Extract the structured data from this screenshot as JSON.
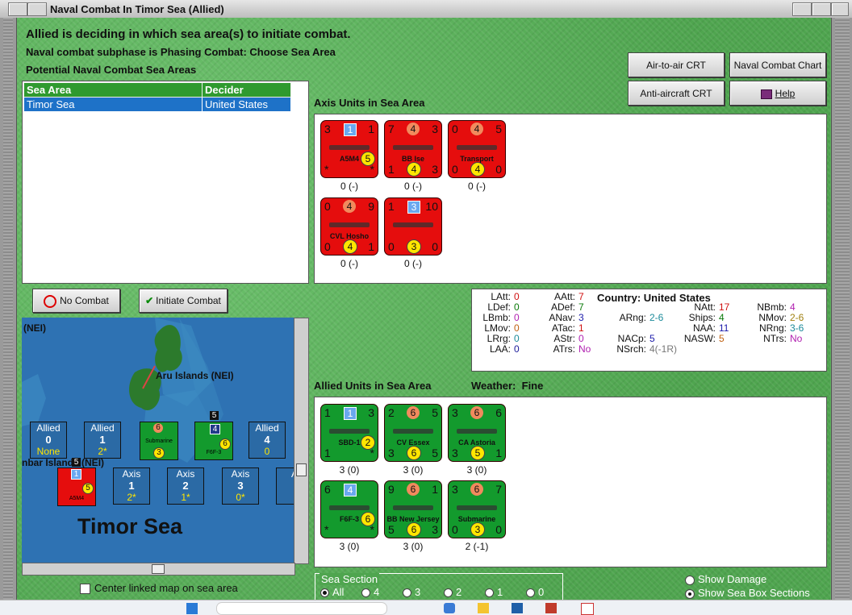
{
  "window": {
    "title": "Naval Combat In Timor Sea (Allied)"
  },
  "header": {
    "line1": "Allied is deciding in which sea area(s) to initiate combat.",
    "line2": "Naval combat subphase is Phasing Combat: Choose Sea Area",
    "line3": "Potential Naval Combat Sea Areas"
  },
  "buttons": {
    "air_to_air": "Air-to-air CRT",
    "naval_chart": "Naval Combat Chart",
    "anti_aircraft": "Anti-aircraft CRT",
    "help": "Help",
    "no_combat": "No Combat",
    "initiate_combat": "Initiate Combat"
  },
  "sea_table": {
    "headers": [
      "Sea Area",
      "Decider"
    ],
    "rows": [
      [
        "Timor Sea",
        "United States"
      ]
    ]
  },
  "axis_section": {
    "label": "Axis Units in Sea Area"
  },
  "axis_units": [
    {
      "name": "A5M4",
      "tl": "3",
      "tr": "1",
      "badge": "1",
      "mid": "5",
      "bl": "*",
      "br": "*",
      "bottom_mid": "",
      "caption": "0 (-)"
    },
    {
      "name": "BB Ise",
      "tl": "7",
      "tr": "3",
      "badge": "4",
      "mid": "",
      "bl": "1",
      "br": "3",
      "bottom_mid": "4",
      "caption": "0 (-)"
    },
    {
      "name": "Transport",
      "tl": "0",
      "tr": "5",
      "badge": "4",
      "mid": "",
      "bl": "0",
      "br": "0",
      "bottom_mid": "4",
      "caption": "0 (-)"
    },
    {
      "name": "CVL Hosho",
      "tl": "0",
      "tr": "9",
      "badge": "4",
      "mid": "",
      "bl": "0",
      "br": "1",
      "bottom_mid": "4",
      "caption": "0 (-)"
    },
    {
      "name": "",
      "tl": "1",
      "tr": "10",
      "badge": "3",
      "mid": "",
      "bl": "0",
      "br": "0",
      "bottom_mid": "3",
      "caption": "0 (-)"
    }
  ],
  "country_stats": {
    "country_label": "Country:",
    "country": "United States",
    "col1": [
      [
        "LAtt:",
        "0"
      ],
      [
        "LDef:",
        "0"
      ],
      [
        "LBmb:",
        "0"
      ],
      [
        "LMov:",
        "0"
      ],
      [
        "LRrg:",
        "0"
      ],
      [
        "LAA:",
        "0"
      ]
    ],
    "col2": [
      [
        "AAtt:",
        "7"
      ],
      [
        "ADef:",
        "7"
      ],
      [
        "ANav:",
        "3"
      ],
      [
        "ATac:",
        "1"
      ],
      [
        "AStr:",
        "0"
      ],
      [
        "ATrs:",
        "No"
      ]
    ],
    "col3": [
      [
        "ARng:",
        "2-6"
      ],
      [
        "NACp:",
        "5"
      ],
      [
        "NSrch:",
        "4(-1R)"
      ]
    ],
    "col4": [
      [
        "NAtt:",
        "17"
      ],
      [
        "Ships:",
        "4"
      ],
      [
        "NAA:",
        "11"
      ],
      [
        "NASW:",
        "5"
      ]
    ],
    "col5": [
      [
        "NBmb:",
        "4"
      ],
      [
        "NMov:",
        "2-6"
      ],
      [
        "NRng:",
        "3-6"
      ],
      [
        "NTrs:",
        "No"
      ]
    ]
  },
  "allied_section": {
    "label": "Allied Units in Sea Area",
    "weather_label": "Weather:",
    "weather": "Fine"
  },
  "allied_units": [
    {
      "name": "SBD-1",
      "tl": "1",
      "tr": "3",
      "badge": "1",
      "bl": "1",
      "br": "*",
      "bottom_mid": "",
      "mid": "2",
      "caption": "3 (0)"
    },
    {
      "name": "CV Essex",
      "tl": "2",
      "tr": "5",
      "badge": "6",
      "bl": "3",
      "br": "5",
      "bottom_mid": "6",
      "mid": "",
      "caption": "3 (0)"
    },
    {
      "name": "CA Astoria",
      "tl": "3",
      "tr": "6",
      "badge": "6",
      "bl": "3",
      "br": "1",
      "bottom_mid": "5",
      "mid": "",
      "caption": "3 (0)"
    },
    {
      "name": "F6F-3",
      "tl": "6",
      "tr": "",
      "badge": "4",
      "bl": "*",
      "br": "*",
      "bottom_mid": "",
      "mid": "6",
      "caption": "3 (0)"
    },
    {
      "name": "BB New Jersey",
      "tl": "9",
      "tr": "1",
      "badge": "6",
      "bl": "5",
      "br": "3",
      "bottom_mid": "6",
      "mid": "",
      "caption": "3 (0)"
    },
    {
      "name": "Submarine",
      "tl": "3",
      "tr": "7",
      "badge": "6",
      "bl": "0",
      "br": "0",
      "bottom_mid": "3",
      "mid": "",
      "caption": "2 (-1)"
    }
  ],
  "map": {
    "nei_label": "(NEI)",
    "aru_label": "Aru Islands (NEI)",
    "anbar_label": "nbar Islands (NEI)",
    "sea_name": "Timor Sea",
    "allied_boxes": [
      {
        "title": "Allied",
        "num": "0",
        "sub": "None"
      },
      {
        "title": "Allied",
        "num": "1",
        "sub": "2*"
      },
      {
        "title": "Allied",
        "num": "4",
        "sub": "0"
      }
    ],
    "axis_boxes": [
      {
        "title": "Axis",
        "num": "1",
        "sub": "2*"
      },
      {
        "title": "Axis",
        "num": "2",
        "sub": "1*"
      },
      {
        "title": "Axis",
        "num": "3",
        "sub": "0*"
      },
      {
        "title": "A",
        "num": "",
        "sub": ""
      }
    ],
    "stack5a": "5",
    "stack5b": "5"
  },
  "bottom": {
    "center_map": "Center linked map on sea area",
    "sea_section_label": "Sea Section",
    "sea_section_options": [
      "All",
      "4",
      "3",
      "2",
      "1",
      "0"
    ],
    "show_damage": "Show Damage",
    "show_sea_box": "Show Sea Box Sections"
  },
  "colors": {
    "axis": "#e50d0d",
    "allied": "#139a2d",
    "table_sel": "#1e72c8",
    "header_green": "#2f9a2f"
  }
}
